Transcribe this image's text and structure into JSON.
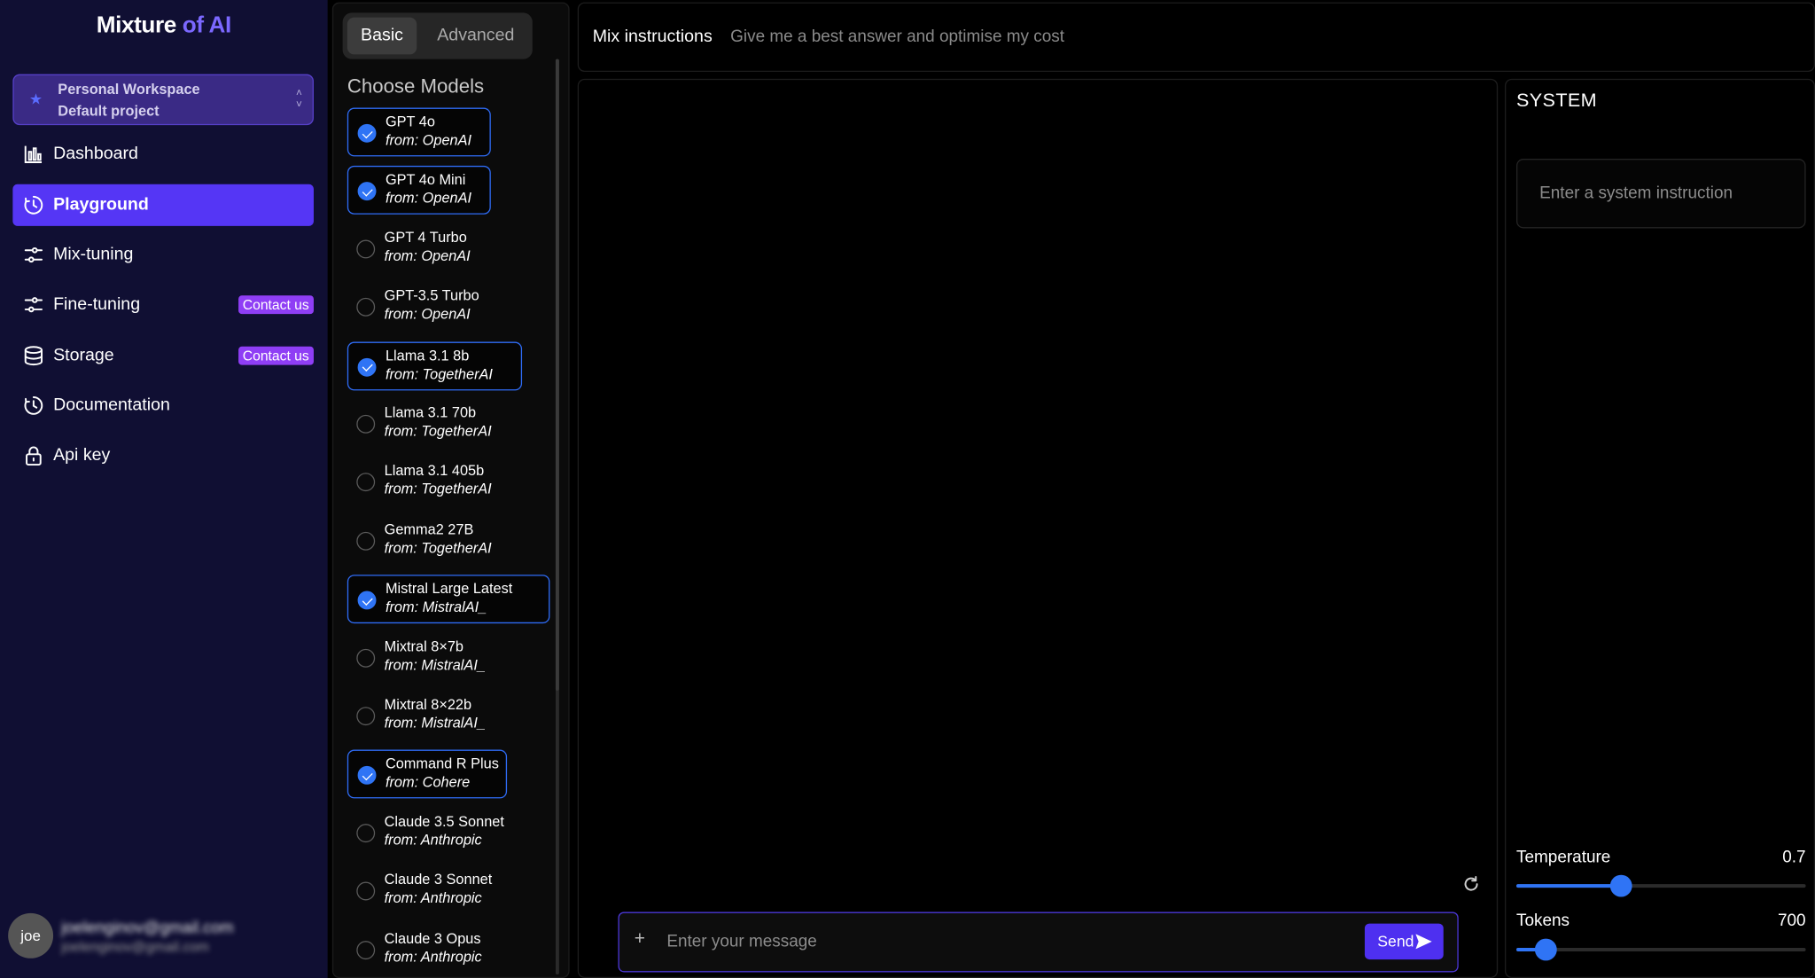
{
  "sidebar": {
    "logo_part1": "Mixture",
    "logo_part2": " of AI",
    "workspace": {
      "name": "Personal Workspace",
      "project": "Default project"
    },
    "items": [
      {
        "label": "Dashboard",
        "icon": "bar-chart-icon",
        "active": false,
        "badge": ""
      },
      {
        "label": "Playground",
        "icon": "clock-icon",
        "active": true,
        "badge": ""
      },
      {
        "label": "Mix-tuning",
        "icon": "sliders-icon",
        "active": false,
        "badge": ""
      },
      {
        "label": "Fine-tuning",
        "icon": "sliders-icon",
        "active": false,
        "badge": "Contact us"
      },
      {
        "label": "Storage",
        "icon": "database-icon",
        "active": false,
        "badge": "Contact us"
      },
      {
        "label": "Documentation",
        "icon": "clock-icon",
        "active": false,
        "badge": ""
      },
      {
        "label": "Api key",
        "icon": "lock-icon",
        "active": false,
        "badge": ""
      }
    ],
    "user": {
      "avatar": "joe",
      "email": "joelenginov@gmail.com",
      "email2": "joelenginov@gmail.com"
    }
  },
  "models_panel": {
    "tabs": [
      "Basic",
      "Advanced"
    ],
    "active_tab": "Basic",
    "heading": "Choose Models",
    "models": [
      {
        "name": "GPT 4o",
        "from": "from: OpenAI",
        "checked": true
      },
      {
        "name": "GPT 4o Mini",
        "from": "from: OpenAI",
        "checked": true
      },
      {
        "name": "GPT 4 Turbo",
        "from": "from: OpenAI",
        "checked": false
      },
      {
        "name": "GPT-3.5 Turbo",
        "from": "from: OpenAI",
        "checked": false
      },
      {
        "name": "Llama 3.1 8b",
        "from": "from: TogetherAI",
        "checked": true
      },
      {
        "name": "Llama 3.1 70b",
        "from": "from: TogetherAI",
        "checked": false
      },
      {
        "name": "Llama 3.1 405b",
        "from": "from: TogetherAI",
        "checked": false
      },
      {
        "name": "Gemma2 27B",
        "from": "from: TogetherAI",
        "checked": false
      },
      {
        "name": "Mistral Large Latest",
        "from": "from: MistralAI_",
        "checked": true
      },
      {
        "name": "Mixtral 8×7b",
        "from": "from: MistralAI_",
        "checked": false
      },
      {
        "name": "Mixtral 8×22b",
        "from": "from: MistralAI_",
        "checked": false
      },
      {
        "name": "Command R Plus",
        "from": "from: Cohere",
        "checked": true
      },
      {
        "name": "Claude 3.5 Sonnet",
        "from": "from: Anthropic",
        "checked": false
      },
      {
        "name": "Claude 3 Sonnet",
        "from": "from: Anthropic",
        "checked": false
      },
      {
        "name": "Claude 3 Opus",
        "from": "from: Anthropic",
        "checked": false
      }
    ]
  },
  "topbar": {
    "label": "Mix instructions",
    "instruction": "Give me a best answer and optimise my cost"
  },
  "chat": {
    "input_placeholder": "Enter your message",
    "plus": "+",
    "send_label": "Send"
  },
  "system": {
    "title": "SYSTEM",
    "placeholder": "Enter a system instruction",
    "temperature": {
      "label": "Temperature",
      "value": "0.7",
      "fraction": 0.36
    },
    "tokens": {
      "label": "Tokens",
      "value": "700",
      "fraction": 0.1
    }
  },
  "colors": {
    "accent": "#5536f5",
    "checkbox": "#2f74f5",
    "badge": "#8f3ef5",
    "sidebar_bg": "#100f33"
  }
}
